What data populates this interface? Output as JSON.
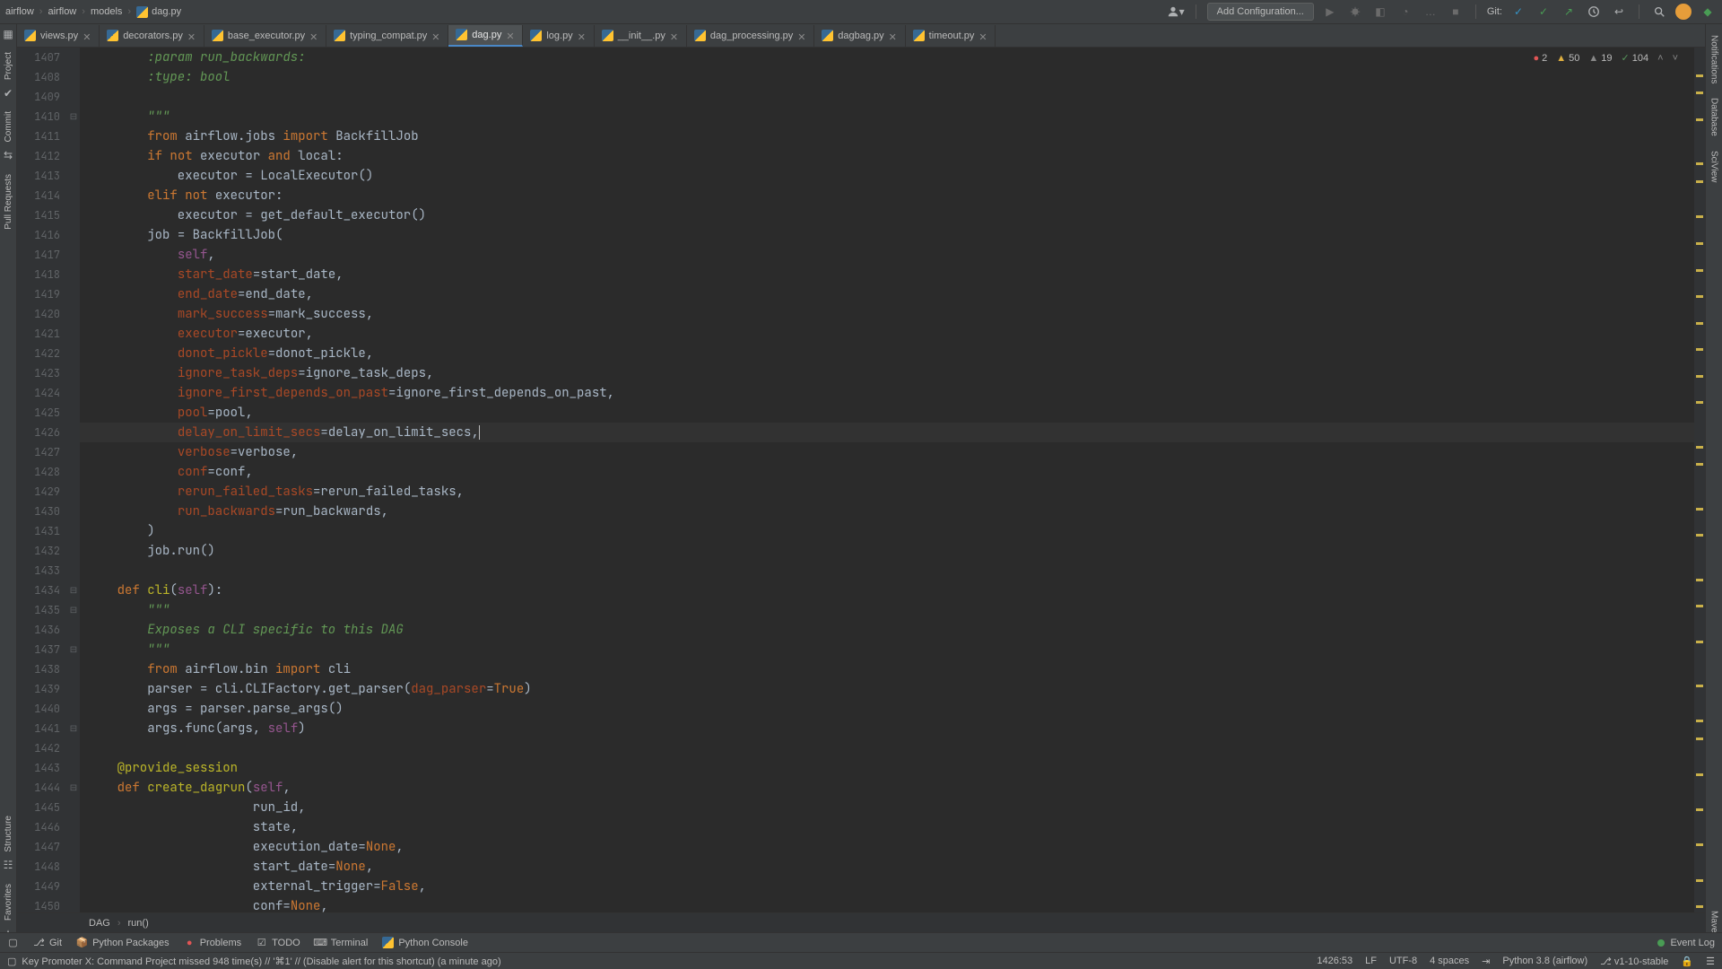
{
  "breadcrumb": {
    "parts": [
      "airflow",
      "airflow",
      "models",
      "dag.py"
    ]
  },
  "nav": {
    "add_config": "Add Configuration...",
    "git": "Git:"
  },
  "tabs": [
    {
      "name": "views.py"
    },
    {
      "name": "decorators.py"
    },
    {
      "name": "base_executor.py"
    },
    {
      "name": "typing_compat.py"
    },
    {
      "name": "dag.py",
      "active": true
    },
    {
      "name": "log.py"
    },
    {
      "name": "__init__.py"
    },
    {
      "name": "dag_processing.py"
    },
    {
      "name": "dagbag.py"
    },
    {
      "name": "timeout.py"
    }
  ],
  "sidebar_left": [
    "Project",
    "Commit",
    "Pull Requests",
    "Structure",
    "Favorites"
  ],
  "sidebar_right": [
    "Notifications",
    "Database",
    "SciView",
    "Maven"
  ],
  "inspect": {
    "errors": "2",
    "warnings": "50",
    "weak": "19",
    "typos": "104"
  },
  "line_start": 1407,
  "current_line": 1426,
  "code": [
    {
      "n": 1407,
      "seg": [
        [
          "docstr",
          "        :param run_backwards:"
        ]
      ]
    },
    {
      "n": 1408,
      "seg": [
        [
          "docstr",
          "        :type: bool"
        ]
      ]
    },
    {
      "n": 1409,
      "seg": [
        [
          "",
          ""
        ]
      ]
    },
    {
      "n": 1410,
      "seg": [
        [
          "docstr",
          "        \"\"\""
        ]
      ]
    },
    {
      "n": 1411,
      "seg": [
        [
          "ident",
          "        "
        ],
        [
          "kw",
          "from"
        ],
        [
          "ident",
          " airflow.jobs "
        ],
        [
          "kw",
          "import"
        ],
        [
          "ident",
          " BackfillJob"
        ]
      ]
    },
    {
      "n": 1412,
      "seg": [
        [
          "ident",
          "        "
        ],
        [
          "kw",
          "if"
        ],
        [
          "ident",
          " "
        ],
        [
          "kw",
          "not"
        ],
        [
          "ident",
          " executor "
        ],
        [
          "kw",
          "and"
        ],
        [
          "ident",
          " local"
        ],
        [
          "op",
          ":"
        ]
      ]
    },
    {
      "n": 1413,
      "seg": [
        [
          "ident",
          "            executor "
        ],
        [
          "op",
          "="
        ],
        [
          "ident",
          " LocalExecutor"
        ],
        [
          "op",
          "()"
        ]
      ]
    },
    {
      "n": 1414,
      "seg": [
        [
          "ident",
          "        "
        ],
        [
          "kw",
          "elif"
        ],
        [
          "ident",
          " "
        ],
        [
          "kw",
          "not"
        ],
        [
          "ident",
          " executor"
        ],
        [
          "op",
          ":"
        ]
      ]
    },
    {
      "n": 1415,
      "seg": [
        [
          "ident",
          "            executor "
        ],
        [
          "op",
          "="
        ],
        [
          "ident",
          " get_default_executor"
        ],
        [
          "op",
          "()"
        ]
      ]
    },
    {
      "n": 1416,
      "seg": [
        [
          "ident",
          "        job "
        ],
        [
          "op",
          "="
        ],
        [
          "ident",
          " BackfillJob"
        ],
        [
          "op",
          "("
        ]
      ]
    },
    {
      "n": 1417,
      "seg": [
        [
          "ident",
          "            "
        ],
        [
          "self",
          "self"
        ],
        [
          "op",
          ","
        ]
      ]
    },
    {
      "n": 1418,
      "seg": [
        [
          "ident",
          "            "
        ],
        [
          "param",
          "start_date"
        ],
        [
          "op",
          "="
        ],
        [
          "ident",
          "start_date"
        ],
        [
          "op",
          ","
        ]
      ]
    },
    {
      "n": 1419,
      "seg": [
        [
          "ident",
          "            "
        ],
        [
          "param",
          "end_date"
        ],
        [
          "op",
          "="
        ],
        [
          "ident",
          "end_date"
        ],
        [
          "op",
          ","
        ]
      ]
    },
    {
      "n": 1420,
      "seg": [
        [
          "ident",
          "            "
        ],
        [
          "param",
          "mark_success"
        ],
        [
          "op",
          "="
        ],
        [
          "ident",
          "mark_success"
        ],
        [
          "op",
          ","
        ]
      ]
    },
    {
      "n": 1421,
      "seg": [
        [
          "ident",
          "            "
        ],
        [
          "param",
          "executor"
        ],
        [
          "op",
          "="
        ],
        [
          "ident",
          "executor"
        ],
        [
          "op",
          ","
        ]
      ]
    },
    {
      "n": 1422,
      "seg": [
        [
          "ident",
          "            "
        ],
        [
          "param",
          "donot_pickle"
        ],
        [
          "op",
          "="
        ],
        [
          "ident",
          "donot_pickle"
        ],
        [
          "op",
          ","
        ]
      ]
    },
    {
      "n": 1423,
      "seg": [
        [
          "ident",
          "            "
        ],
        [
          "param",
          "ignore_task_deps"
        ],
        [
          "op",
          "="
        ],
        [
          "ident",
          "ignore_task_deps"
        ],
        [
          "op",
          ","
        ]
      ]
    },
    {
      "n": 1424,
      "seg": [
        [
          "ident",
          "            "
        ],
        [
          "param",
          "ignore_first_depends_on_past"
        ],
        [
          "op",
          "="
        ],
        [
          "ident",
          "ignore_first_depends_on_past"
        ],
        [
          "op",
          ","
        ]
      ]
    },
    {
      "n": 1425,
      "seg": [
        [
          "ident",
          "            "
        ],
        [
          "param",
          "pool"
        ],
        [
          "op",
          "="
        ],
        [
          "ident",
          "pool"
        ],
        [
          "op",
          ","
        ]
      ]
    },
    {
      "n": 1426,
      "seg": [
        [
          "ident",
          "            "
        ],
        [
          "param",
          "delay_on_limit_secs"
        ],
        [
          "op",
          "="
        ],
        [
          "ident",
          "delay_on_limit_secs"
        ],
        [
          "op",
          ","
        ]
      ],
      "current": true,
      "bulb": true
    },
    {
      "n": 1427,
      "seg": [
        [
          "ident",
          "            "
        ],
        [
          "param",
          "verbose"
        ],
        [
          "op",
          "="
        ],
        [
          "ident",
          "verbose"
        ],
        [
          "op",
          ","
        ]
      ]
    },
    {
      "n": 1428,
      "seg": [
        [
          "ident",
          "            "
        ],
        [
          "param",
          "conf"
        ],
        [
          "op",
          "="
        ],
        [
          "ident",
          "conf"
        ],
        [
          "op",
          ","
        ]
      ]
    },
    {
      "n": 1429,
      "seg": [
        [
          "ident",
          "            "
        ],
        [
          "param",
          "rerun_failed_tasks"
        ],
        [
          "op",
          "="
        ],
        [
          "ident",
          "rerun_failed_tasks"
        ],
        [
          "op",
          ","
        ]
      ]
    },
    {
      "n": 1430,
      "seg": [
        [
          "ident",
          "            "
        ],
        [
          "param",
          "run_backwards"
        ],
        [
          "op",
          "="
        ],
        [
          "ident",
          "run_backwards"
        ],
        [
          "op",
          ","
        ]
      ]
    },
    {
      "n": 1431,
      "seg": [
        [
          "ident",
          "        "
        ],
        [
          "op",
          ")"
        ]
      ]
    },
    {
      "n": 1432,
      "seg": [
        [
          "ident",
          "        job.run"
        ],
        [
          "op",
          "()"
        ]
      ]
    },
    {
      "n": 1433,
      "seg": [
        [
          "",
          ""
        ]
      ]
    },
    {
      "n": 1434,
      "seg": [
        [
          "ident",
          "    "
        ],
        [
          "kw",
          "def"
        ],
        [
          "ident",
          " "
        ],
        [
          "decor",
          "cli"
        ],
        [
          "op",
          "("
        ],
        [
          "self",
          "self"
        ],
        [
          "op",
          "):"
        ]
      ]
    },
    {
      "n": 1435,
      "seg": [
        [
          "docstr",
          "        \"\"\""
        ]
      ]
    },
    {
      "n": 1436,
      "seg": [
        [
          "docstr",
          "        Exposes a CLI specific to this DAG"
        ]
      ]
    },
    {
      "n": 1437,
      "seg": [
        [
          "docstr",
          "        \"\"\""
        ]
      ]
    },
    {
      "n": 1438,
      "seg": [
        [
          "ident",
          "        "
        ],
        [
          "kw",
          "from"
        ],
        [
          "ident",
          " airflow.bin "
        ],
        [
          "kw",
          "import"
        ],
        [
          "ident",
          " cli"
        ]
      ]
    },
    {
      "n": 1439,
      "seg": [
        [
          "ident",
          "        parser "
        ],
        [
          "op",
          "="
        ],
        [
          "ident",
          " cli.CLIFactory.get_parser"
        ],
        [
          "op",
          "("
        ],
        [
          "param",
          "dag_parser"
        ],
        [
          "op",
          "="
        ],
        [
          "kw",
          "True"
        ],
        [
          "op",
          ")"
        ]
      ]
    },
    {
      "n": 1440,
      "seg": [
        [
          "ident",
          "        args "
        ],
        [
          "op",
          "="
        ],
        [
          "ident",
          " parser.parse_args"
        ],
        [
          "op",
          "()"
        ]
      ]
    },
    {
      "n": 1441,
      "seg": [
        [
          "ident",
          "        args.func"
        ],
        [
          "op",
          "("
        ],
        [
          "ident",
          "args"
        ],
        [
          "op",
          ", "
        ],
        [
          "self",
          "self"
        ],
        [
          "op",
          ")"
        ]
      ]
    },
    {
      "n": 1442,
      "seg": [
        [
          "",
          ""
        ]
      ]
    },
    {
      "n": 1443,
      "seg": [
        [
          "ident",
          "    "
        ],
        [
          "decor",
          "@provide_session"
        ]
      ]
    },
    {
      "n": 1444,
      "seg": [
        [
          "ident",
          "    "
        ],
        [
          "kw",
          "def"
        ],
        [
          "ident",
          " "
        ],
        [
          "decor",
          "create_dagrun"
        ],
        [
          "op",
          "("
        ],
        [
          "self",
          "self"
        ],
        [
          "op",
          ","
        ]
      ]
    },
    {
      "n": 1445,
      "seg": [
        [
          "ident",
          "                      run_id"
        ],
        [
          "op",
          ","
        ]
      ]
    },
    {
      "n": 1446,
      "seg": [
        [
          "ident",
          "                      state"
        ],
        [
          "op",
          ","
        ]
      ]
    },
    {
      "n": 1447,
      "seg": [
        [
          "ident",
          "                      execution_date"
        ],
        [
          "op",
          "="
        ],
        [
          "kw",
          "None"
        ],
        [
          "op",
          ","
        ]
      ]
    },
    {
      "n": 1448,
      "seg": [
        [
          "ident",
          "                      start_date"
        ],
        [
          "op",
          "="
        ],
        [
          "kw",
          "None"
        ],
        [
          "op",
          ","
        ]
      ]
    },
    {
      "n": 1449,
      "seg": [
        [
          "ident",
          "                      external_trigger"
        ],
        [
          "op",
          "="
        ],
        [
          "kw",
          "False"
        ],
        [
          "op",
          ","
        ]
      ]
    },
    {
      "n": 1450,
      "seg": [
        [
          "ident",
          "                      conf"
        ],
        [
          "op",
          "="
        ],
        [
          "kw",
          "None"
        ],
        [
          "op",
          ","
        ]
      ]
    }
  ],
  "bottom_breadcrumb": [
    "DAG",
    "run()"
  ],
  "tools": {
    "git": "Git",
    "packages": "Python Packages",
    "problems": "Problems",
    "todo": "TODO",
    "terminal": "Terminal",
    "pyconsole": "Python Console",
    "event_log": "Event Log"
  },
  "status": {
    "msg": "Key Promoter X: Command Project missed 948 time(s) // '⌘1' // (Disable alert for this shortcut) (a minute ago)",
    "pos": "1426:53",
    "le": "LF",
    "enc": "UTF-8",
    "indent": "4 spaces",
    "interpreter": "Python 3.8 (airflow)",
    "branch": "v1-10-stable"
  },
  "markers": [
    {
      "pct": 3,
      "cls": "m-y"
    },
    {
      "pct": 5,
      "cls": "m-y"
    },
    {
      "pct": 8,
      "cls": "m-y"
    },
    {
      "pct": 13,
      "cls": "m-y"
    },
    {
      "pct": 15,
      "cls": "m-y"
    },
    {
      "pct": 19,
      "cls": "m-y"
    },
    {
      "pct": 22,
      "cls": "m-y"
    },
    {
      "pct": 25,
      "cls": "m-y"
    },
    {
      "pct": 28,
      "cls": "m-y"
    },
    {
      "pct": 31,
      "cls": "m-y"
    },
    {
      "pct": 34,
      "cls": "m-y"
    },
    {
      "pct": 37,
      "cls": "m-y"
    },
    {
      "pct": 40,
      "cls": "m-y"
    },
    {
      "pct": 45,
      "cls": "m-y"
    },
    {
      "pct": 47,
      "cls": "m-y"
    },
    {
      "pct": 52,
      "cls": "m-y"
    },
    {
      "pct": 55,
      "cls": "m-y"
    },
    {
      "pct": 60,
      "cls": "m-y"
    },
    {
      "pct": 63,
      "cls": "m-y"
    },
    {
      "pct": 67,
      "cls": "m-y"
    },
    {
      "pct": 72,
      "cls": "m-y"
    },
    {
      "pct": 76,
      "cls": "m-y"
    },
    {
      "pct": 78,
      "cls": "m-y"
    },
    {
      "pct": 82,
      "cls": "m-y"
    },
    {
      "pct": 86,
      "cls": "m-y"
    },
    {
      "pct": 90,
      "cls": "m-y"
    },
    {
      "pct": 94,
      "cls": "m-y"
    },
    {
      "pct": 97,
      "cls": "m-y"
    }
  ]
}
